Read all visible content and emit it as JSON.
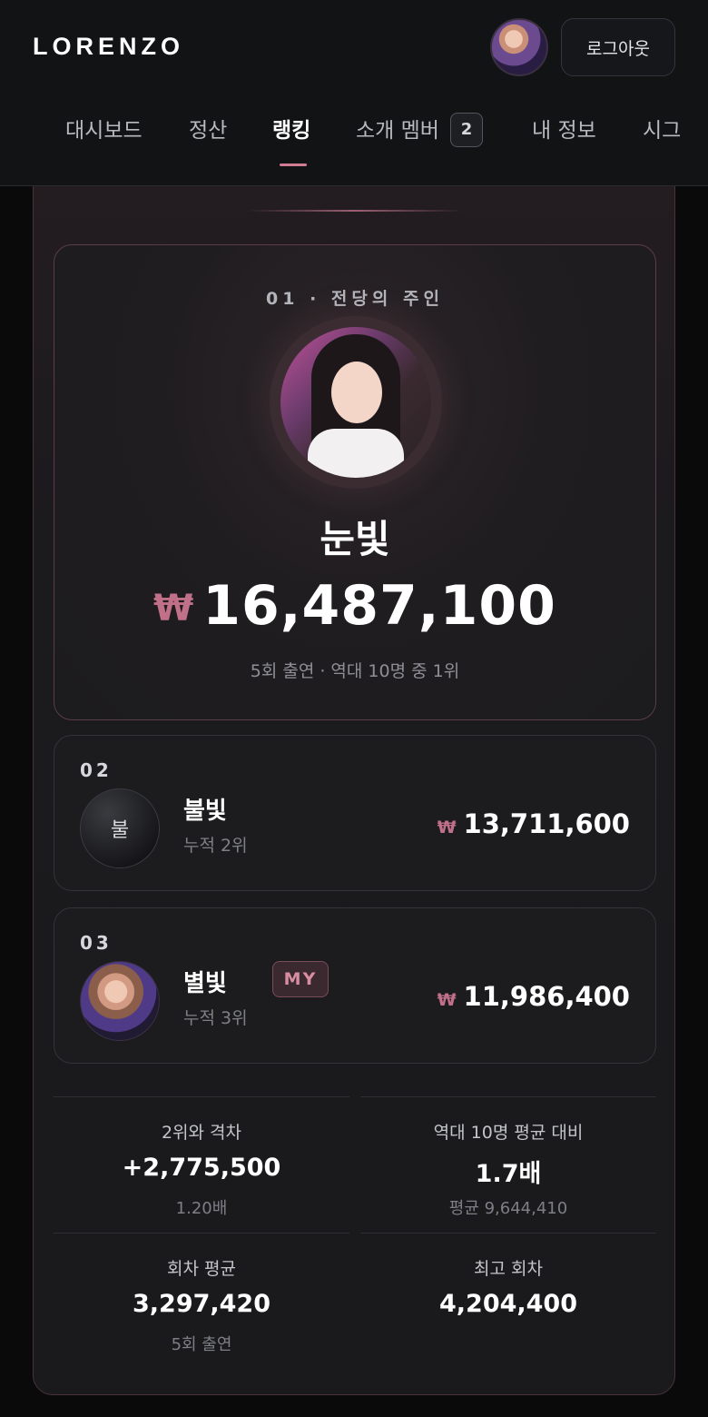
{
  "header": {
    "logo": "LORENZO",
    "logout_label": "로그아웃"
  },
  "nav": {
    "items": [
      {
        "label": "대시보드"
      },
      {
        "label": "정산"
      },
      {
        "label": "랭킹"
      },
      {
        "label": "소개 멤버",
        "badge": "2"
      },
      {
        "label": "내 정보"
      },
      {
        "label": "시그"
      }
    ],
    "active": "랭킹"
  },
  "ranking": {
    "first": {
      "rank_label": "01 · 전당의 주인",
      "name": "눈빛",
      "currency": "₩",
      "amount": "16,487,100",
      "sub": "5회 출연 · 역대 10명 중 1위"
    },
    "others": [
      {
        "rank": "02",
        "name": "불빛",
        "initial": "불",
        "sub": "누적 2위",
        "currency": "₩",
        "amount": "13,711,600"
      },
      {
        "rank": "03",
        "name": "별빛",
        "badge": "MY",
        "sub": "누적 3위",
        "currency": "₩",
        "amount": "11,986,400"
      }
    ]
  },
  "stats": [
    {
      "label": "2위와 격차",
      "value": "+2,775,500",
      "note": "1.20배"
    },
    {
      "label": "역대 10명 평균 대비",
      "value": "1.7배",
      "note": "평균 9,644,410"
    },
    {
      "label": "회차 평균",
      "value": "3,297,420",
      "note": "5회 출연"
    },
    {
      "label": "최고 회차",
      "value": "4,204,400",
      "note": ""
    }
  ],
  "colors": {
    "accent": "#d07d93",
    "currency": "#c07088",
    "background": "#0a0a0b"
  }
}
